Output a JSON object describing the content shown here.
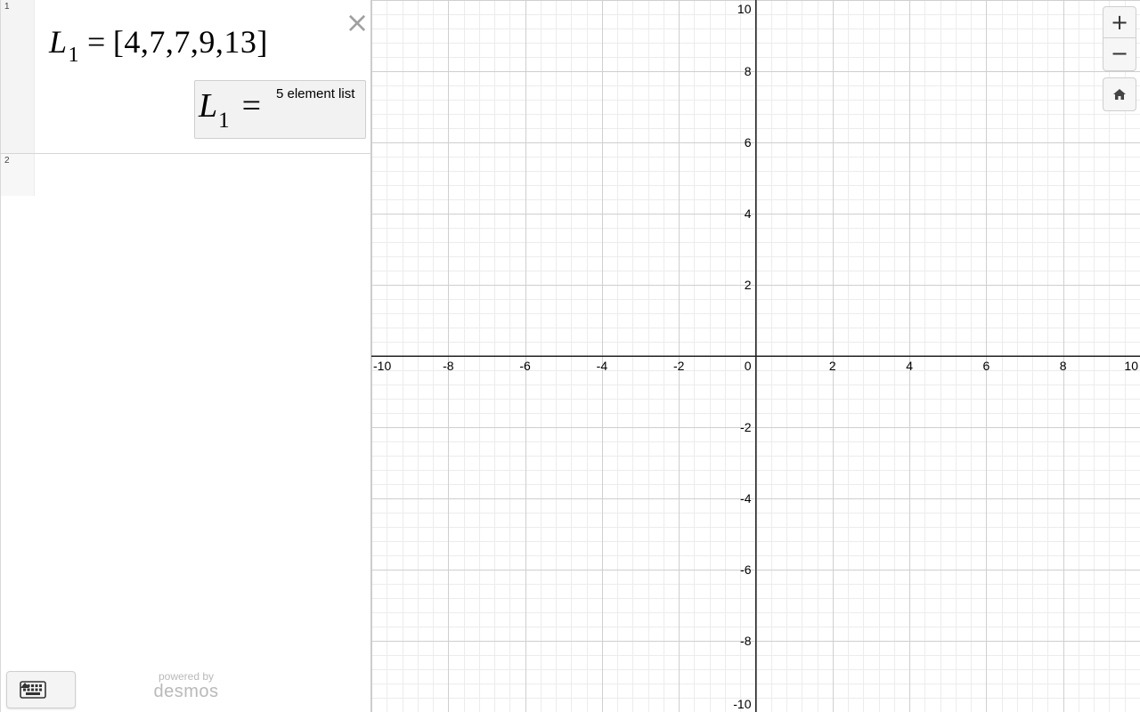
{
  "expressions": [
    {
      "index": "1",
      "latex": {
        "var": "L",
        "sub": "1",
        "eq": "=",
        "value": "[4,7,7,9,13]"
      },
      "evaluation": {
        "var": "L",
        "sub": "1",
        "eq": "=",
        "text": "5 element list"
      }
    },
    {
      "index": "2"
    }
  ],
  "icons": {
    "close": "close-icon",
    "keypad": "keyboard-icon",
    "keypad_caret": "caret-up-icon",
    "zoom_in": "plus-icon",
    "zoom_out": "minus-icon",
    "home": "home-icon"
  },
  "controls": {
    "close_symbol": "×",
    "zoom_in_symbol": "+",
    "zoom_out_symbol": "−"
  },
  "branding": {
    "powered_by": "powered by",
    "wordmark": "desmos"
  },
  "graph": {
    "x_range": [
      -10,
      10
    ],
    "y_range": [
      -10,
      10
    ],
    "major_step": 2,
    "minor_step": 0.4,
    "grid": true,
    "x_tick_labels": [
      "-10",
      "-8",
      "-6",
      "-4",
      "-2",
      "2",
      "4",
      "6",
      "8",
      "10"
    ],
    "y_tick_labels": [
      "10",
      "8",
      "6",
      "4",
      "2",
      "-2",
      "-4",
      "-6",
      "-8",
      "-10"
    ],
    "origin_label": "0",
    "colors": {
      "minor_grid": "#ececec",
      "major_grid": "#cfcfcf",
      "axis": "#222222"
    }
  }
}
